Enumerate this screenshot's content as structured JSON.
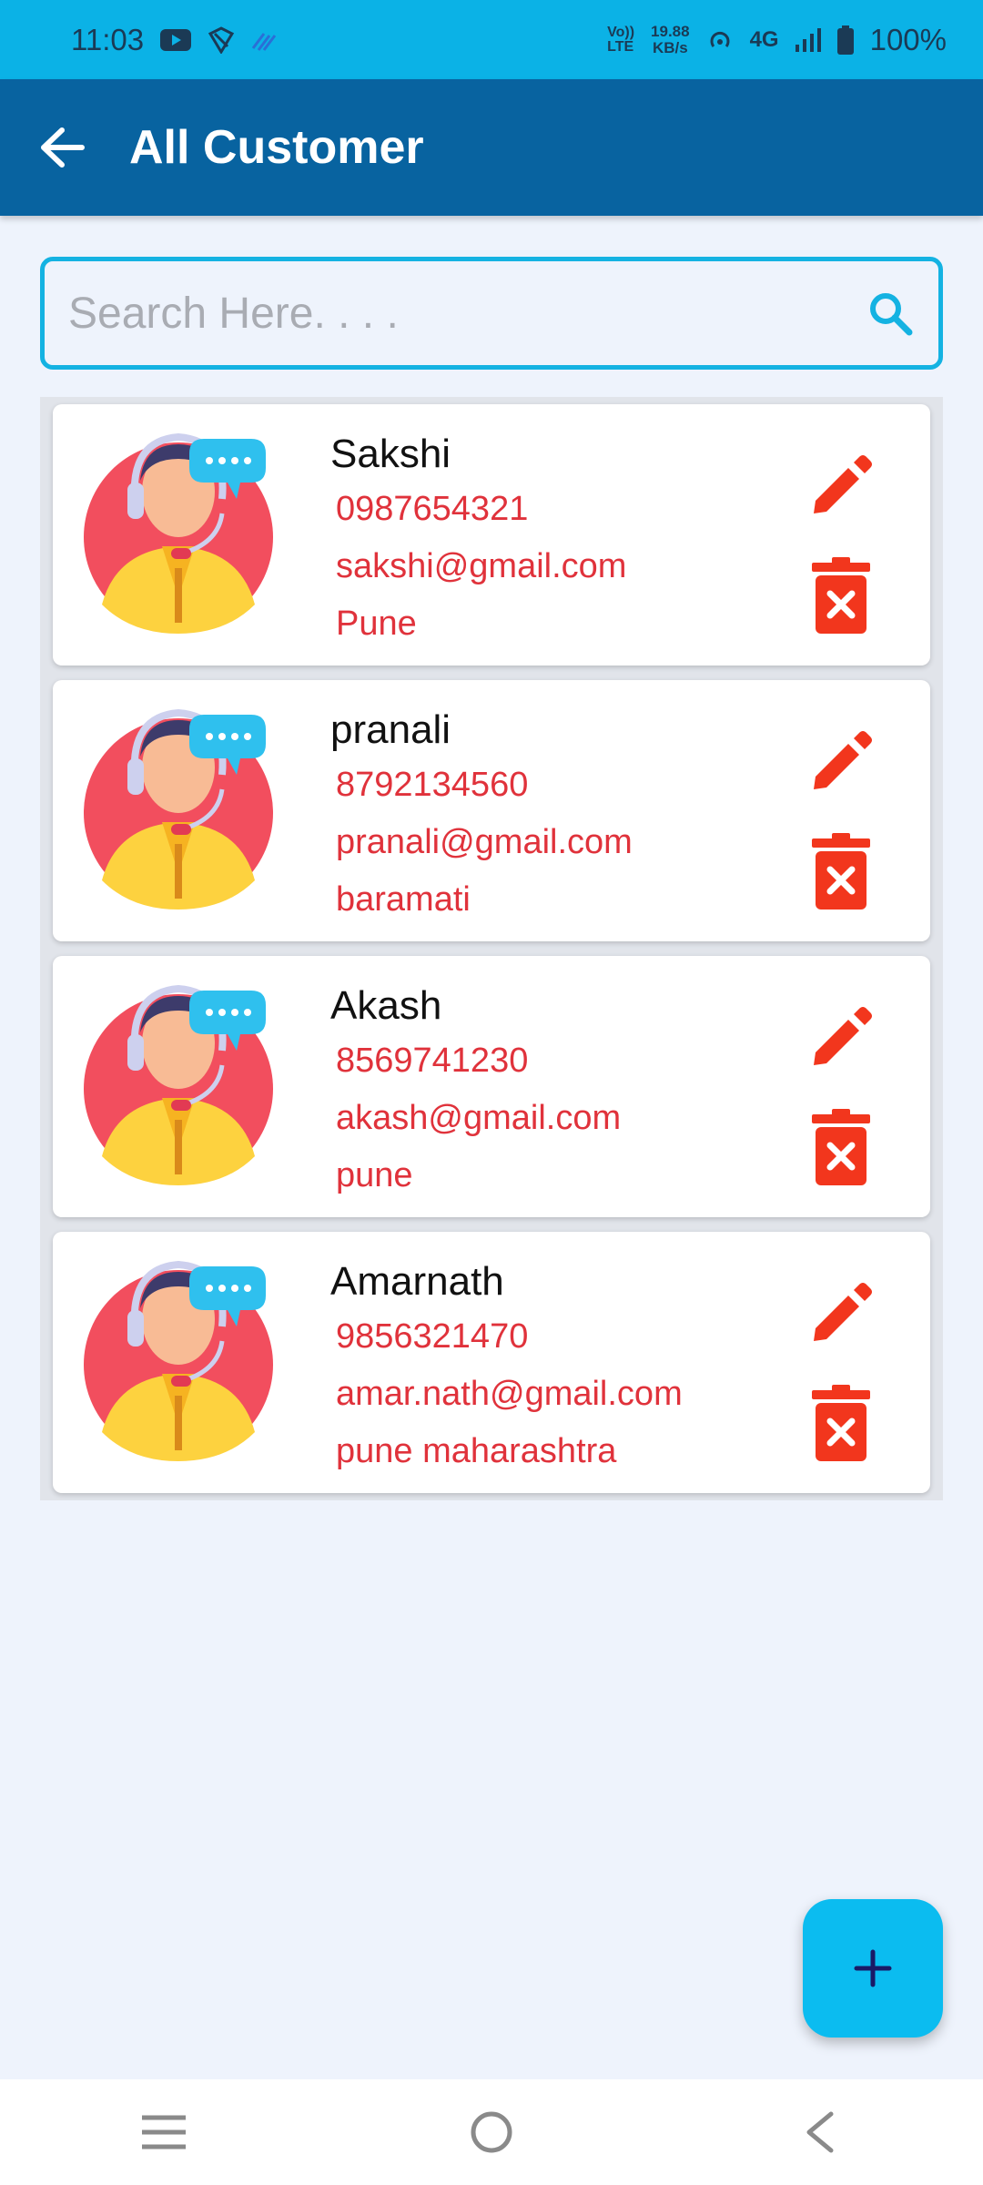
{
  "status_bar": {
    "time": "11:03",
    "lte_top": "Vo))",
    "lte_bottom": "LTE",
    "speed_value": "19.88",
    "speed_unit": "KB/s",
    "network": "4G",
    "battery": "100%"
  },
  "app_bar": {
    "title": "All Customer",
    "back_icon": "arrow-left-icon"
  },
  "search": {
    "placeholder": "Search Here. . . .",
    "value": "",
    "icon": "search-icon"
  },
  "customers": [
    {
      "name": "Sakshi",
      "phone": "0987654321",
      "email": "sakshi@gmail.com",
      "city": "Pune"
    },
    {
      "name": "pranali",
      "phone": "8792134560",
      "email": "pranali@gmail.com",
      "city": "baramati"
    },
    {
      "name": "Akash",
      "phone": "8569741230",
      "email": "akash@gmail.com",
      "city": "pune"
    },
    {
      "name": "Amarnath",
      "phone": "9856321470",
      "email": "amar.nath@gmail.com",
      "city": "pune maharashtra"
    }
  ],
  "fab": {
    "icon": "plus-icon"
  },
  "colors": {
    "status_bar": "#0bb2e6",
    "app_bar": "#0863a0",
    "accent": "#0bbcf0",
    "detail_text": "#e0323b",
    "action_red": "#f2361d"
  }
}
